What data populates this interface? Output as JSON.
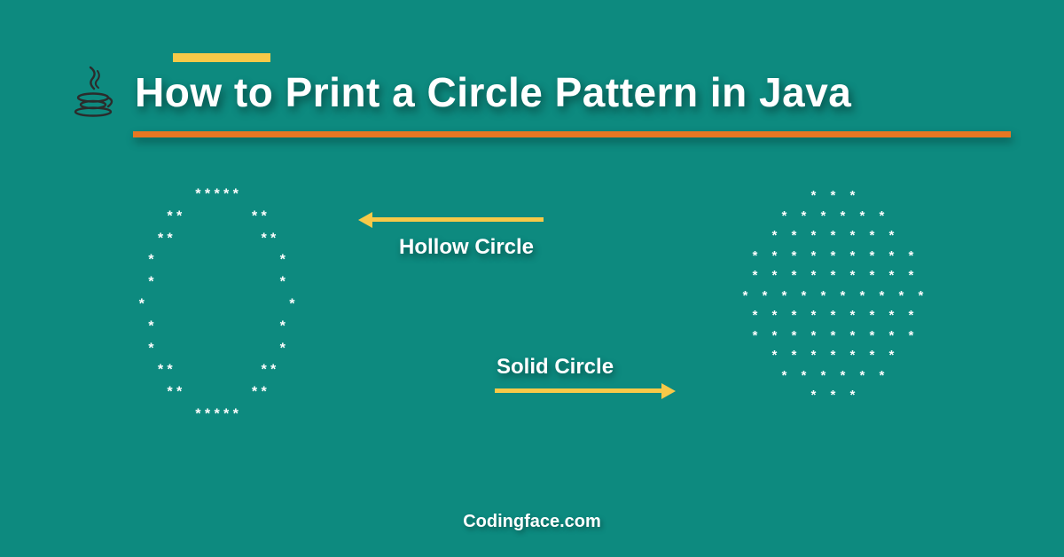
{
  "title": "How to Print a Circle Pattern in Java",
  "labels": {
    "hollow": "Hollow Circle",
    "solid": "Solid Circle"
  },
  "footer": "Codingface.com",
  "icon_name": "java-icon",
  "colors": {
    "background": "#0d8a7f",
    "accent_yellow": "#f7c948",
    "accent_orange": "#e87722",
    "text": "#ffffff"
  },
  "patterns": {
    "hollow": "      *****\n   **       **\n  **         **\n *             *\n *             *\n*               *\n *             *\n *             *\n  **         **\n   **       **\n      *****",
    "solid": "* * *\n* * * * * *\n* * * * * * *\n* * * * * * * * *\n* * * * * * * * *\n* * * * * * * * * *\n* * * * * * * * *\n* * * * * * * * *\n* * * * * * *\n* * * * * *\n* * *"
  }
}
